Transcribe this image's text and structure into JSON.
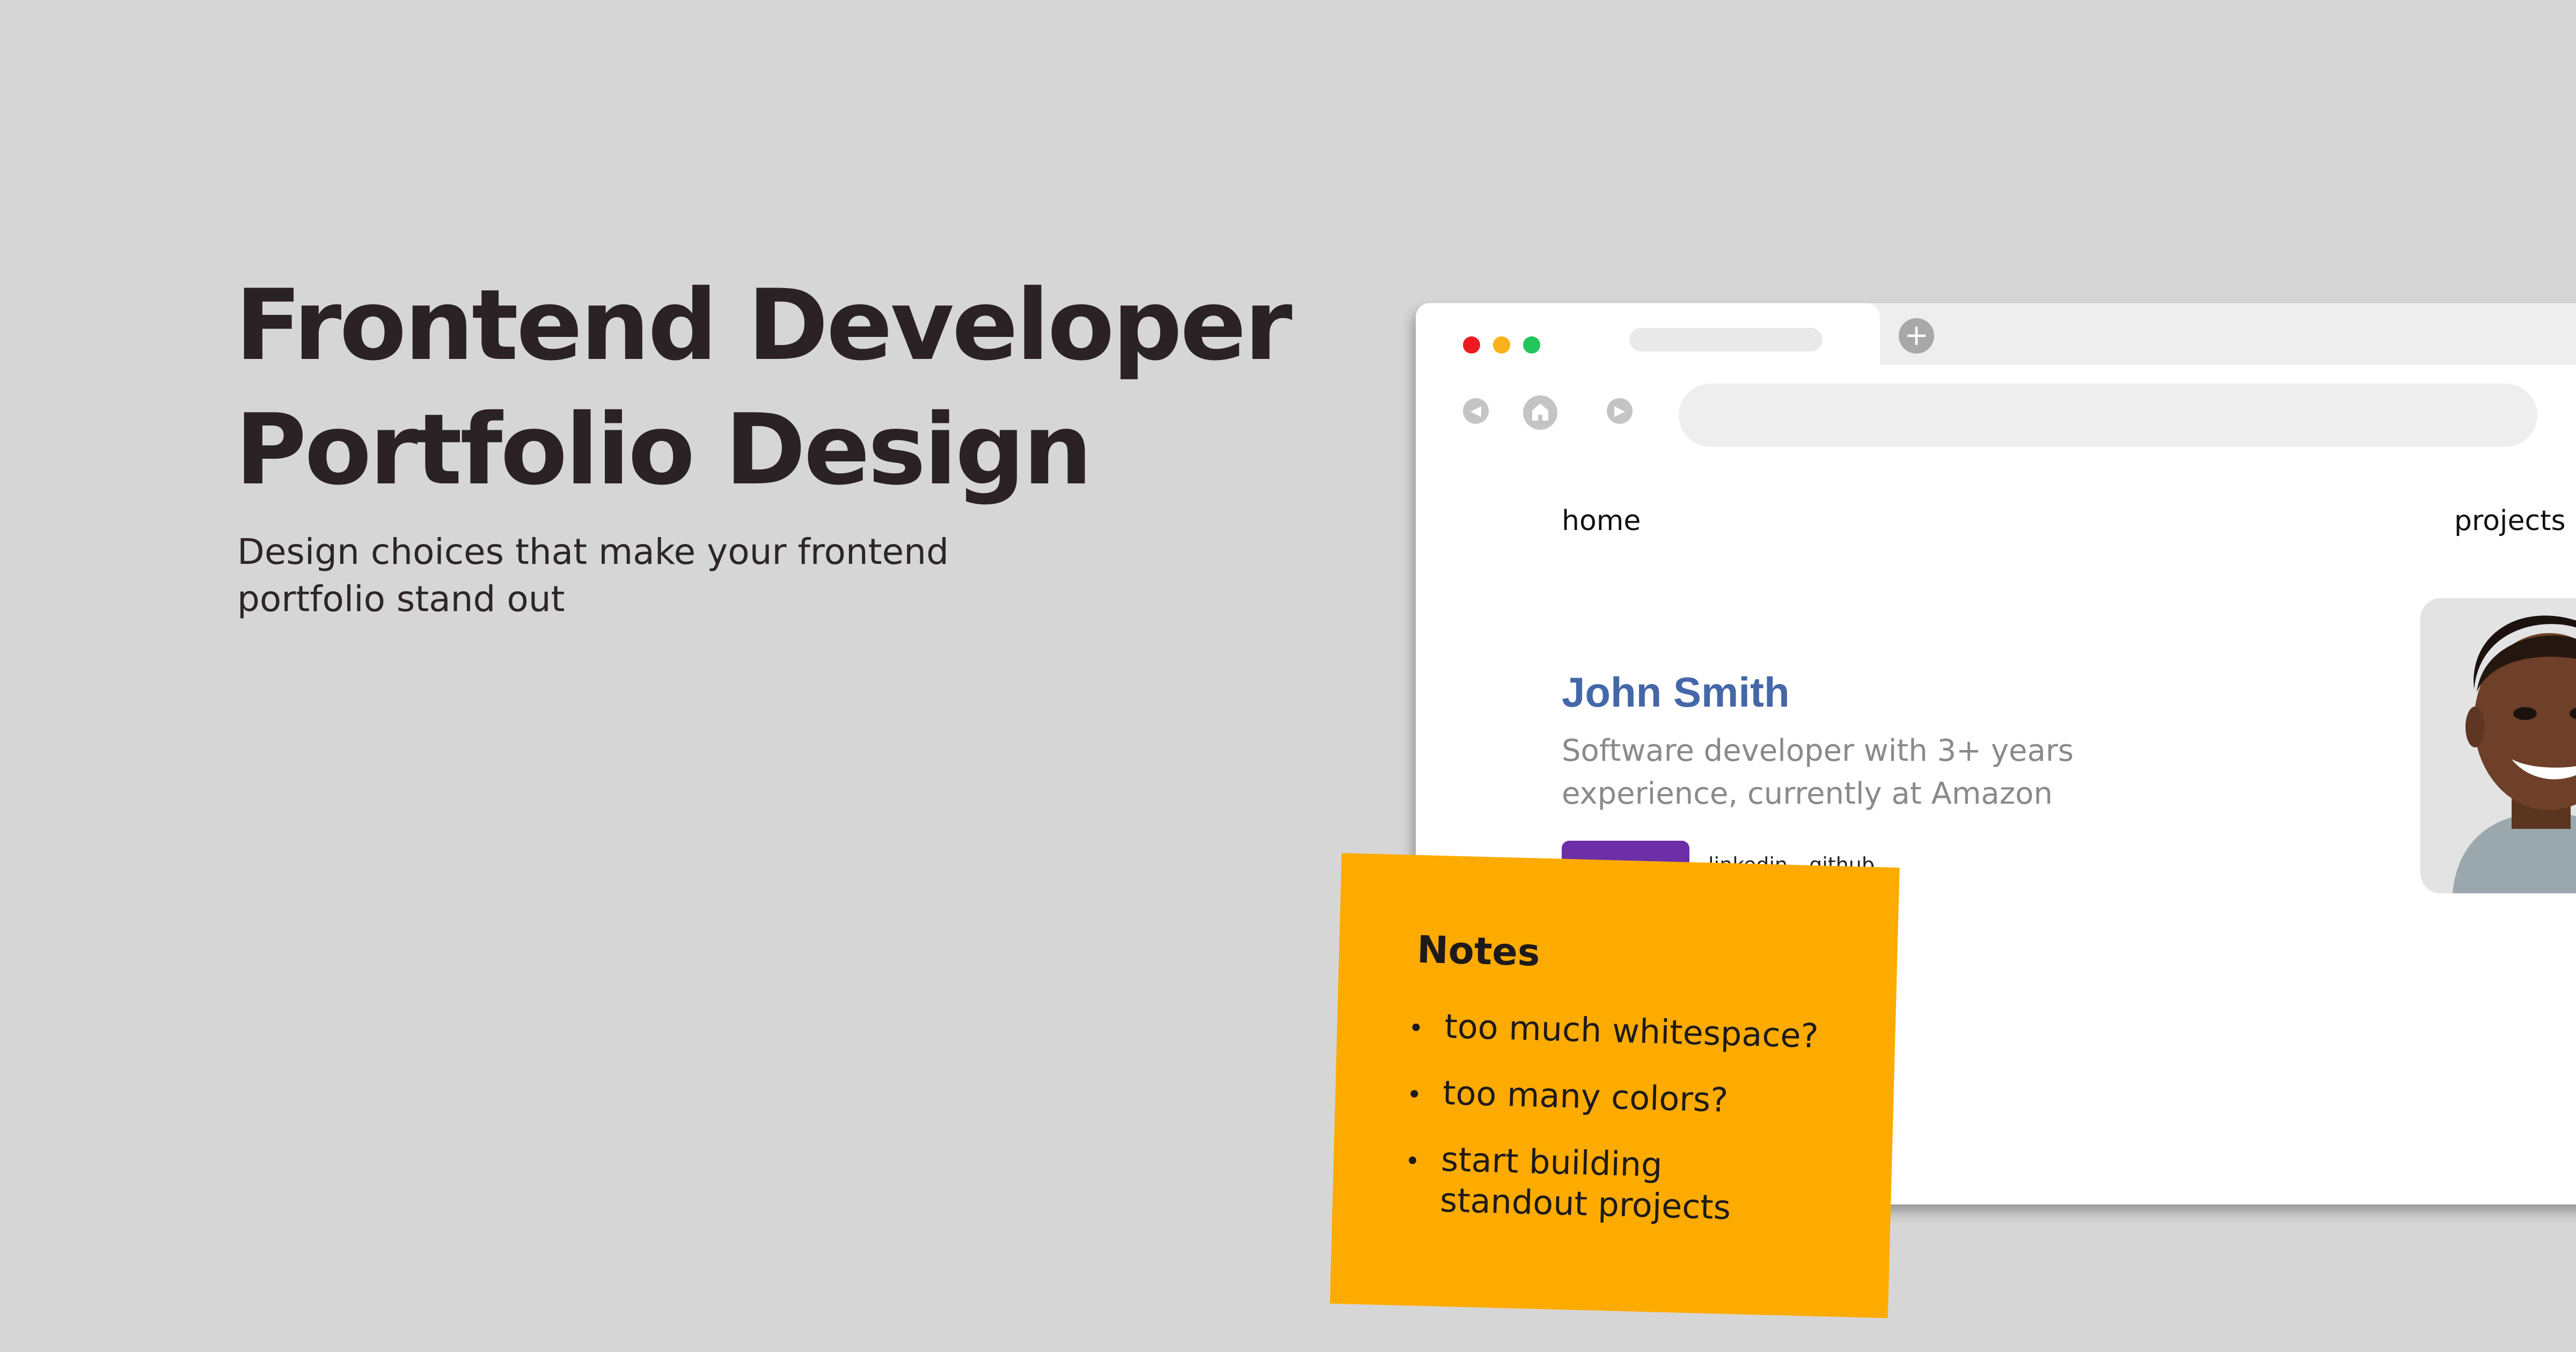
{
  "hero": {
    "title_line1": "Frontend Developer",
    "title_line2": "Portfolio Design",
    "subtitle_line1": "Design choices that make your frontend",
    "subtitle_line2": "portfolio stand out"
  },
  "browser": {
    "new_tab_symbol": "+",
    "dots": [
      "#ee1b24",
      "#fbb219",
      "#22c65a"
    ]
  },
  "site": {
    "nav": {
      "home": "home",
      "projects": "projects"
    },
    "profile": {
      "name": "John Smith",
      "bio_line1": "Software developer with 3+ years",
      "bio_line2": "experience, currently at Amazon"
    },
    "social": {
      "linkedin": "linkedin",
      "github": "github"
    },
    "colors": {
      "name": "#4467a8",
      "cta": "#6d2fa7"
    }
  },
  "notes": {
    "title": "Notes",
    "items": [
      {
        "line1": "too much whitespace?"
      },
      {
        "line1": "too many colors?"
      },
      {
        "line1": "start building",
        "line2": "standout projects"
      }
    ],
    "color": "#fdab00"
  }
}
